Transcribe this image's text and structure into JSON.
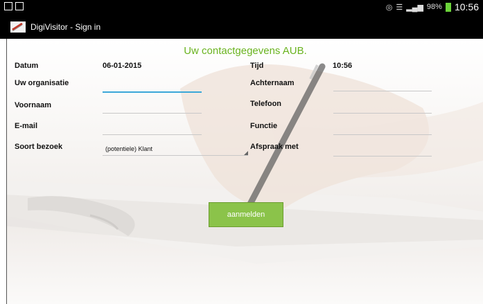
{
  "statusbar": {
    "left_icons": [
      "image-icon",
      "screenshot-icon"
    ],
    "battery": "98%",
    "time": "10:56",
    "battery_color": "#6bd43a"
  },
  "app": {
    "title": "DigiVisitor - Sign in"
  },
  "form": {
    "heading": "Uw contactgegevens AUB.",
    "heading_color": "#6ab31f",
    "datum_label": "Datum",
    "datum_value": "06-01-2015",
    "tijd_label": "Tijd",
    "tijd_value": "10:56",
    "organisatie_label": "Uw organisatie",
    "organisatie_value": "",
    "achternaam_label": "Achternaam",
    "achternaam_value": "",
    "voornaam_label": "Voornaam",
    "voornaam_value": "",
    "telefoon_label": "Telefoon",
    "telefoon_value": "",
    "email_label": "E-mail",
    "email_value": "",
    "functie_label": "Functie",
    "functie_value": "",
    "soort_label": "Soort bezoek",
    "soort_value": "(potentiele) Klant",
    "afspraak_label": "Afspraak met",
    "afspraak_value": "",
    "submit_label": "aanmelden",
    "submit_color": "#8bc34a",
    "focus_color": "#3aa7d8"
  }
}
